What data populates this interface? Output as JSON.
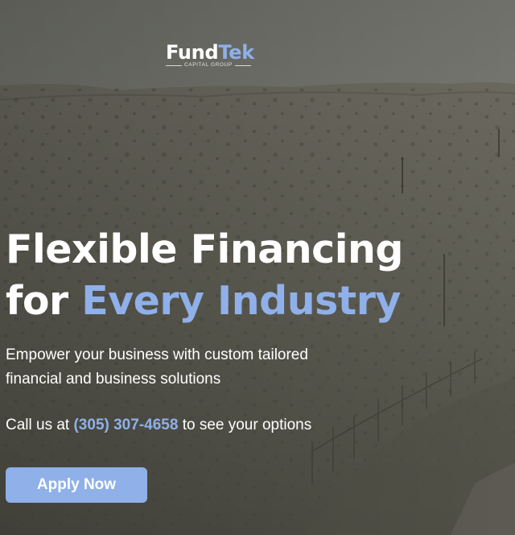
{
  "brand": {
    "name_part1": "Fund",
    "name_part2": "Tek",
    "tagline": "CAPITAL GROUP"
  },
  "hero": {
    "headline_line1": "Flexible Financing",
    "headline_line2_prefix": "for ",
    "headline_line2_accent": "Every Industry",
    "subtext": "Empower your business with custom tailored financial and business solutions",
    "call_prefix": "Call us at ",
    "phone": "(305) 307-4658",
    "call_suffix": " to see your options",
    "cta_label": "Apply Now"
  },
  "colors": {
    "accent": "#8fb0e8",
    "text": "#ffffff"
  }
}
